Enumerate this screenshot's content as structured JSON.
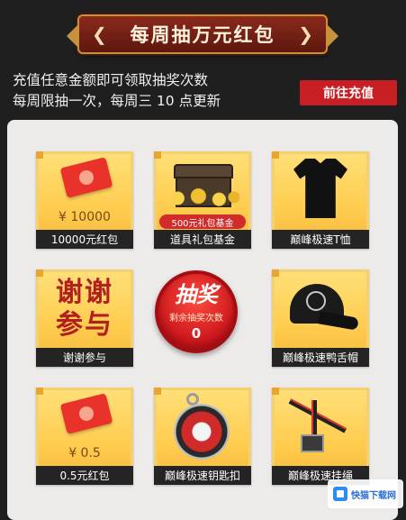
{
  "banner": {
    "title": "每周抽万元红包",
    "left_chevron": "❮",
    "right_chevron": "❯"
  },
  "info": {
    "line1": "充值任意金额即可领取抽奖次数",
    "line2": "每周限抽一次，每周三 10 点更新",
    "recharge_button": "前往充值"
  },
  "prizes": [
    {
      "label": "10000元红包",
      "amount": "¥ 10000",
      "icon": "red-packet-icon"
    },
    {
      "label": "道具礼包基金",
      "tag": "500元礼包基金",
      "icon": "treasure-chest-icon"
    },
    {
      "label": "巅峰极速T恤",
      "icon": "tshirt-icon"
    },
    {
      "label": "谢谢参与",
      "art_text_1": "谢谢",
      "art_text_2": "参与",
      "icon": "thanks-icon"
    },
    {
      "label": "巅峰极速鸭舌帽",
      "icon": "cap-icon"
    },
    {
      "label": "0.5元红包",
      "amount": "¥ 0.5",
      "icon": "red-packet-icon"
    },
    {
      "label": "巅峰极速钥匙扣",
      "icon": "keychain-icon"
    },
    {
      "label": "巅峰极速挂绳",
      "icon": "lanyard-icon"
    }
  ],
  "draw": {
    "title": "抽奖",
    "subtitle": "剩余抽奖次数",
    "count": "0"
  },
  "watermark": {
    "text": "快猫下载网"
  },
  "colors": {
    "accent_red": "#c81f24",
    "card_gold": "#ffcc4d",
    "panel_bg": "#ecebea"
  }
}
